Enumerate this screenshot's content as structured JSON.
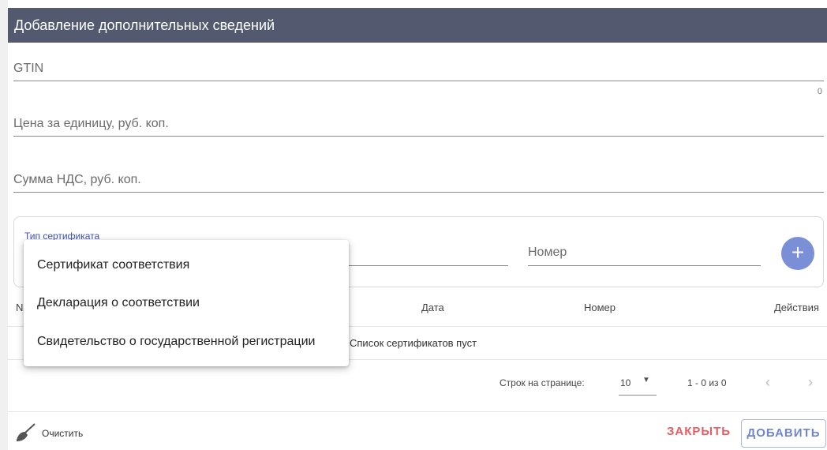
{
  "dialog": {
    "title": "Добавление дополнительных сведений"
  },
  "fields": {
    "gtin": {
      "label": "GTIN",
      "counter": "0"
    },
    "price": {
      "label": "Цена за единицу, руб. коп."
    },
    "vat": {
      "label": "Сумма НДС, руб. коп."
    }
  },
  "certificate": {
    "type_label": "Тип сертификата",
    "number_label": "Номер",
    "add_icon": "plus-icon"
  },
  "dropdown": {
    "options": [
      "Сертификат соответствия",
      "Декларация о соответствии",
      "Свидетельство о государственной регистрации"
    ]
  },
  "table": {
    "columns": [
      "N",
      "Дата",
      "Номер",
      "Действия"
    ],
    "empty_text": "Список сертификатов пуст"
  },
  "pagination": {
    "rows_label": "Строк на странице:",
    "rows_value": "10",
    "range": "1 - 0 из 0"
  },
  "footer": {
    "clear_label": "Очистить",
    "close_label": "ЗАКРЫТЬ",
    "add_label": "ДОБАВИТЬ"
  },
  "colors": {
    "header": "#535a6f",
    "accent": "#7b8fd6",
    "danger": "#e85d63"
  }
}
